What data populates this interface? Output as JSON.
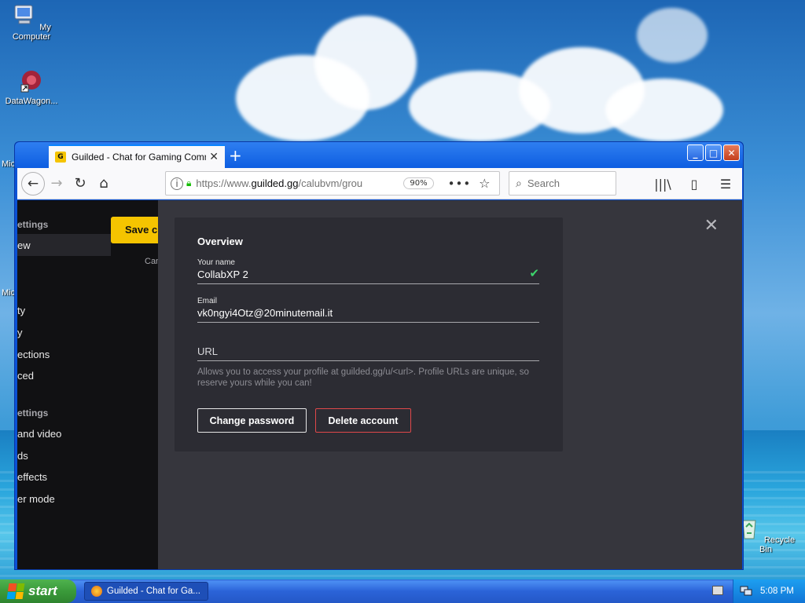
{
  "desktop": {
    "icons": [
      {
        "label": "My Computer",
        "icon": "computer-icon"
      },
      {
        "label": "DataWagon...",
        "icon": "datawagon-icon"
      },
      {
        "label": "Recycle Bin",
        "icon": "recycle-bin-icon"
      }
    ],
    "partial_labels": [
      "Mic",
      "Mic"
    ]
  },
  "browser": {
    "tab": {
      "title": "Guilded - Chat for Gaming Commun",
      "favicon": "G",
      "close": "✕"
    },
    "new_tab": "+",
    "window_controls": {
      "minimize": "_",
      "maximize": "□",
      "close": "✕"
    },
    "nav": {
      "back": "←",
      "forward": "→",
      "reload": "↻",
      "home": "⌂"
    },
    "url": {
      "scheme": "https://www.",
      "host": "guilded.gg",
      "path": "/calubvm/grou"
    },
    "zoom": "90%",
    "page_actions": "•••",
    "bookmark": "☆",
    "search_placeholder": "Search",
    "toolbar": {
      "library": "|||\\",
      "sidebar": "▯",
      "menu": "☰"
    }
  },
  "settings_sidebar": {
    "save_label": "Save changes",
    "cancel_label": "Cancel",
    "items": [
      {
        "text": "ettings",
        "type": "heading"
      },
      {
        "text": "ew",
        "type": "item"
      },
      {
        "text": "ty",
        "type": "item"
      },
      {
        "text": "y",
        "type": "item"
      },
      {
        "text": "ections",
        "type": "item"
      },
      {
        "text": "ced",
        "type": "item"
      },
      {
        "text": "ettings",
        "type": "heading"
      },
      {
        "text": "and video",
        "type": "item"
      },
      {
        "text": "ds",
        "type": "item"
      },
      {
        "text": "effects",
        "type": "item"
      },
      {
        "text": "er mode",
        "type": "item"
      }
    ]
  },
  "overview": {
    "title": "Overview",
    "name_label": "Your name",
    "name_value": "CollabXP 2",
    "email_label": "Email",
    "email_value": "vk0ngyi4Otz@20minutemail.it",
    "url_placeholder": "URL",
    "hint": "Allows you to access your profile at guilded.gg/u/<url>. Profile URLs are unique, so reserve yours while you can!",
    "change_password": "Change password",
    "delete_account": "Delete account",
    "close": "✕"
  },
  "taskbar": {
    "start": "start",
    "task_title": "Guilded - Chat for Ga...",
    "clock": "5:08 PM"
  },
  "colors": {
    "accent": "#f5c400",
    "danger": "#e0484a",
    "success": "#3dd46c"
  }
}
